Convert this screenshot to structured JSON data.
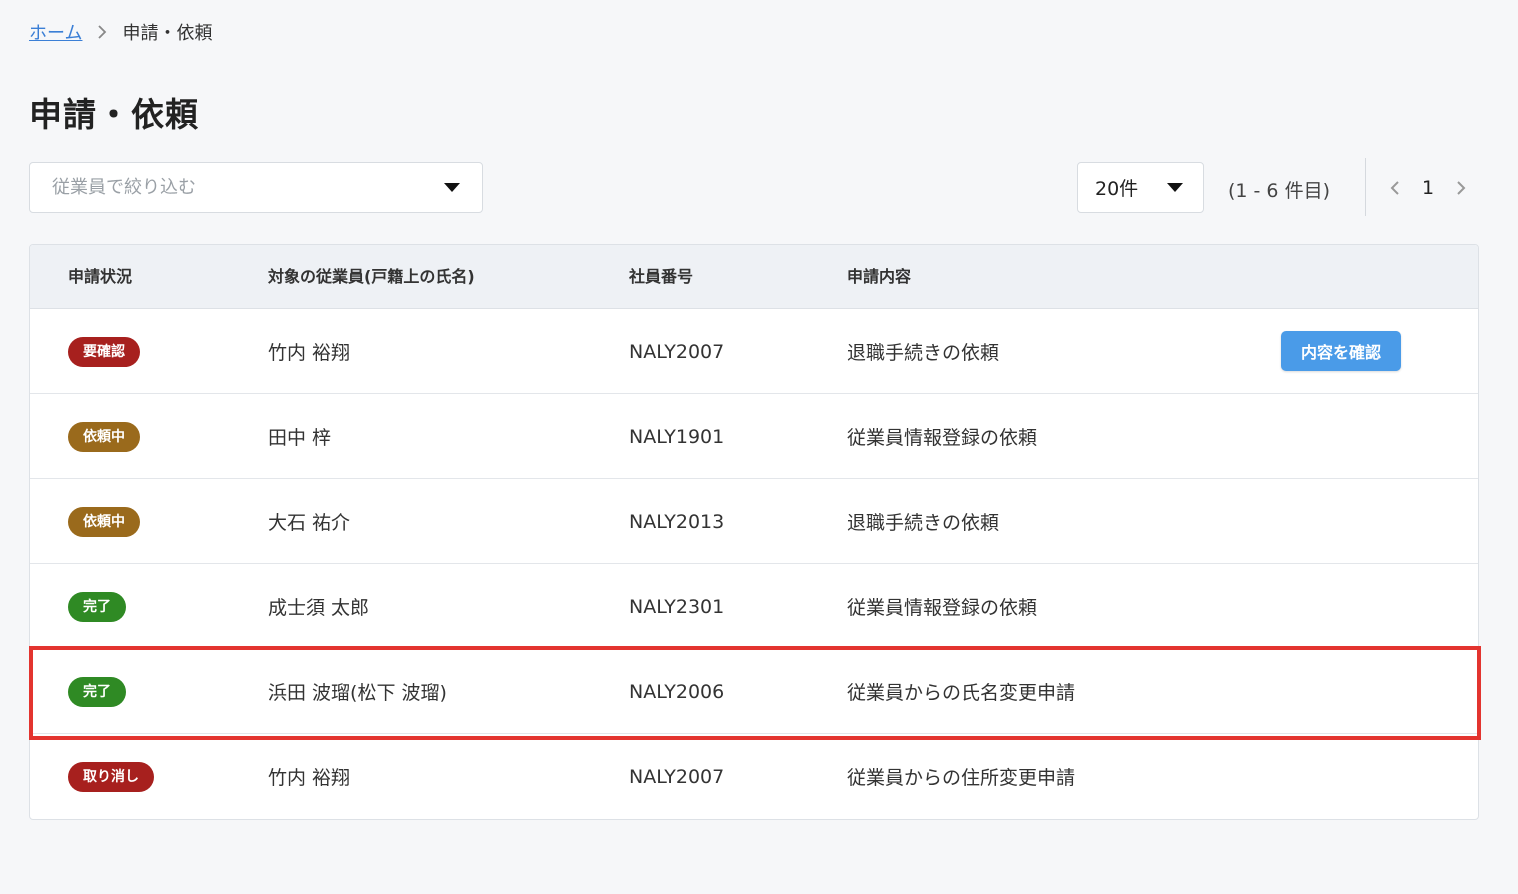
{
  "breadcrumb": {
    "home": "ホーム",
    "current": "申請・依頼"
  },
  "page": {
    "title": "申請・依頼"
  },
  "filter": {
    "placeholder": "従業員で絞り込む"
  },
  "pagination": {
    "per_page": "20件",
    "range": "(1 - 6 件目)",
    "current_page": "1"
  },
  "table": {
    "headers": {
      "status": "申請状況",
      "employee": "対象の従業員(戸籍上の氏名)",
      "number": "社員番号",
      "content": "申請内容"
    },
    "confirm_label": "内容を確認",
    "rows": [
      {
        "status": "要確認",
        "status_color": "#a7201e",
        "employee": "竹内 裕翔",
        "number": "NALY2007",
        "content": "退職手続きの依頼"
      },
      {
        "status": "依頼中",
        "status_color": "#9a6a1c",
        "employee": "田中 梓",
        "number": "NALY1901",
        "content": "従業員情報登録の依頼"
      },
      {
        "status": "依頼中",
        "status_color": "#9a6a1c",
        "employee": "大石 祐介",
        "number": "NALY2013",
        "content": "退職手続きの依頼"
      },
      {
        "status": "完了",
        "status_color": "#2f8a24",
        "employee": "成士須 太郎",
        "number": "NALY2301",
        "content": "従業員情報登録の依頼"
      },
      {
        "status": "完了",
        "status_color": "#2f8a24",
        "employee": "浜田 波瑠(松下 波瑠)",
        "number": "NALY2006",
        "content": "従業員からの氏名変更申請"
      },
      {
        "status": "取り消し",
        "status_color": "#a7201e",
        "employee": "竹内 裕翔",
        "number": "NALY2007",
        "content": "従業員からの住所変更申請"
      }
    ]
  },
  "colors": {
    "accent": "#4a9be8",
    "highlight": "#e3342f",
    "link": "#3b7fd6"
  }
}
